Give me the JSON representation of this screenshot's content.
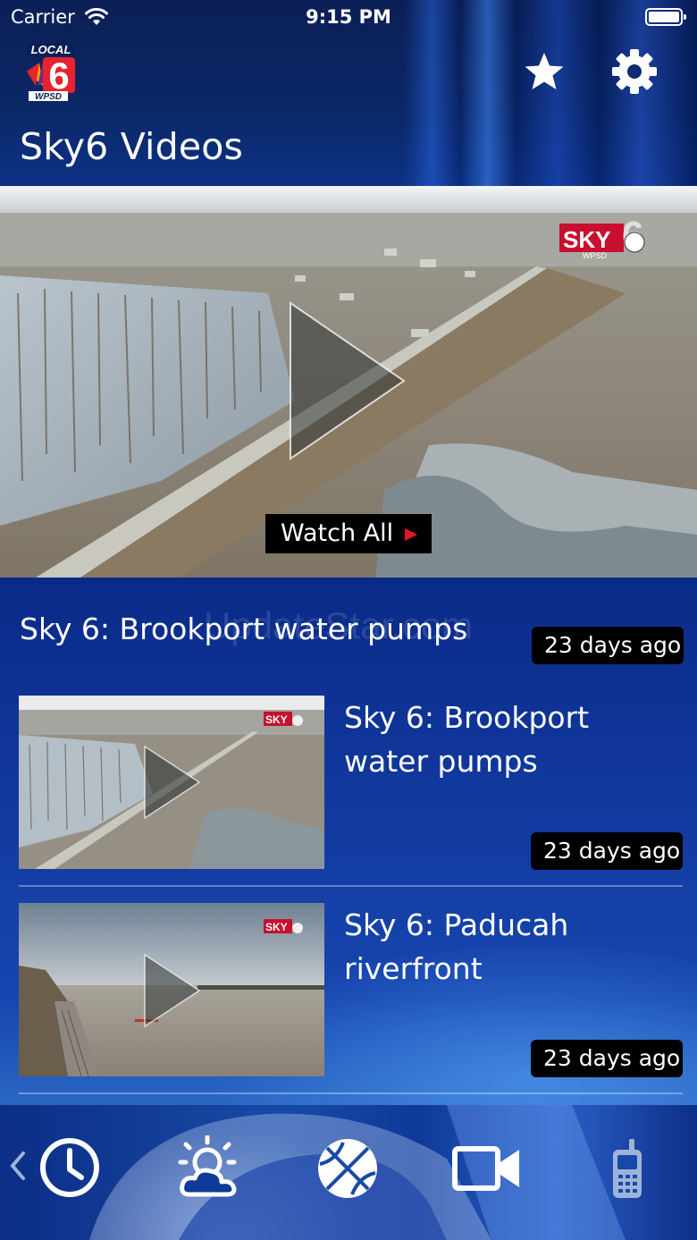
{
  "status_bar": {
    "carrier": "Carrier",
    "time": "9:15 PM"
  },
  "header": {
    "logo_text_top": "LOCAL",
    "logo_text_number": "6",
    "logo_text_bottom": "WPSD",
    "title": "Sky6 Videos",
    "icons": [
      "star-icon",
      "gear-icon"
    ]
  },
  "hero": {
    "badge_text": "SKY",
    "badge_number": "6",
    "badge_sub": "WPSD",
    "watch_all_label": "Watch All"
  },
  "featured": {
    "title": "Sky 6: Brookport water pumps",
    "time_ago": "23 days ago",
    "watermark": "UpdateStar.com"
  },
  "videos": [
    {
      "title_line1": "Sky 6: Brookport",
      "title_line2": "water pumps",
      "time_ago": "23 days ago"
    },
    {
      "title_line1": "Sky 6: Paducah",
      "title_line2": "riverfront",
      "time_ago": "23 days ago"
    }
  ],
  "tab_bar": {
    "tabs": [
      "clock-icon",
      "weather-icon",
      "basketball-icon",
      "video-camera-icon",
      "mobile-phone-icon"
    ],
    "colors": {
      "active": "#ffffff",
      "inactive": "#9db3d9"
    }
  },
  "colors": {
    "accent_red": "#e4162a",
    "header_blue": "#0b2868",
    "list_blue": "#123aa0"
  }
}
